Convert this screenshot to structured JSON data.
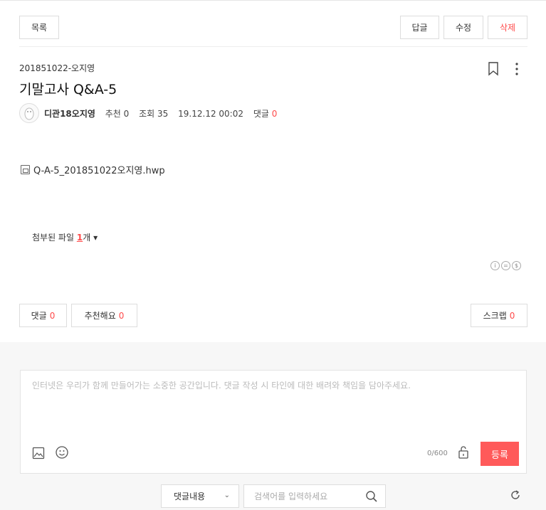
{
  "toolbar": {
    "list_label": "목록",
    "reply_label": "답글",
    "edit_label": "수정",
    "delete_label": "삭제"
  },
  "post": {
    "category": "201851022-오지영",
    "title": "기말고사 Q&A-5",
    "author": "디관18오지영",
    "recommend_label": "추천",
    "recommend_count": "0",
    "views_label": "조회",
    "views_count": "35",
    "date": "19.12.12 00:02",
    "comment_label": "댓글",
    "comment_count": "0",
    "file_name": "Q-A-5_201851022오지영.hwp",
    "attach_prefix": "첨부된 파일 ",
    "attach_count": "1",
    "attach_suffix": "개"
  },
  "actions": {
    "comment_label": "댓글",
    "comment_count": "0",
    "recommend_label": "추천해요",
    "recommend_count": "0",
    "scrap_label": "스크랩",
    "scrap_count": "0"
  },
  "comment_box": {
    "placeholder": "인터넷은 우리가 함께 만들어가는 소중한 공간입니다. 댓글 작성 시 타인에 대한 배려와 책임을 담아주세요.",
    "counter": "0/600",
    "submit_label": "등록"
  },
  "comment_search": {
    "select_value": "댓글내용",
    "placeholder": "검색어를 입력하세요"
  },
  "colors": {
    "accent": "#ff4b4b",
    "submit_bg": "#ff5a5a"
  },
  "icons": [
    "bookmark-icon",
    "more-icon",
    "avatar-icon",
    "file-icon",
    "cc-license-icon",
    "image-icon",
    "emoticon-icon",
    "lock-icon",
    "chevron-down-icon",
    "search-icon",
    "refresh-icon"
  ]
}
